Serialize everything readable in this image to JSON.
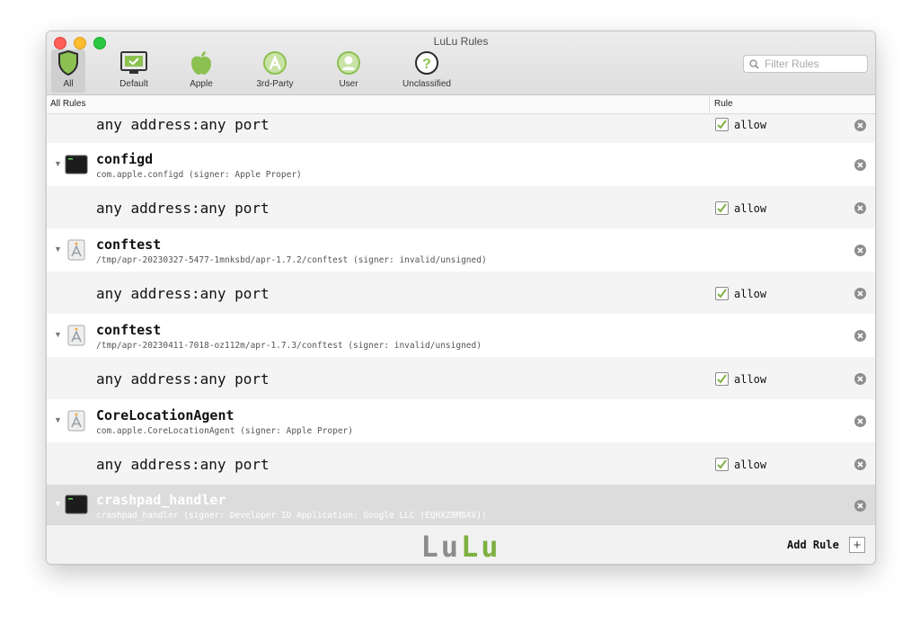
{
  "window": {
    "title": "LuLu Rules"
  },
  "toolbar": {
    "items": [
      {
        "label": "All",
        "icon": "shield-icon"
      },
      {
        "label": "Default",
        "icon": "monitor-icon"
      },
      {
        "label": "Apple",
        "icon": "apple-icon"
      },
      {
        "label": "3rd-Party",
        "icon": "app-store-icon"
      },
      {
        "label": "User",
        "icon": "user-icon"
      },
      {
        "label": "Unclassified",
        "icon": "question-icon"
      }
    ],
    "search_placeholder": "Filter Rules"
  },
  "columns": {
    "all_rules": "All Rules",
    "rule": "Rule"
  },
  "colors": {
    "green": "#7fb042",
    "toolbar_green": "#8cc152",
    "selected_row": "#dcdcdc",
    "logo_gray": "#8c8c8c"
  },
  "rows": [
    {
      "type": "rule",
      "text": "any address:any port",
      "action": "allow"
    },
    {
      "type": "app",
      "name": "configd",
      "path": "com.apple.configd (signer: Apple Proper)",
      "icon": "terminal-icon"
    },
    {
      "type": "rule",
      "text": "any address:any port",
      "action": "allow"
    },
    {
      "type": "app",
      "name": "conftest",
      "path": "/tmp/apr-20230327-5477-1mnksbd/apr-1.7.2/conftest (signer: invalid/unsigned)",
      "icon": "generic-app-icon"
    },
    {
      "type": "rule",
      "text": "any address:any port",
      "action": "allow"
    },
    {
      "type": "app",
      "name": "conftest",
      "path": "/tmp/apr-20230411-7018-oz112m/apr-1.7.3/conftest (signer: invalid/unsigned)",
      "icon": "generic-app-icon"
    },
    {
      "type": "rule",
      "text": "any address:any port",
      "action": "allow"
    },
    {
      "type": "app",
      "name": "CoreLocationAgent",
      "path": "com.apple.CoreLocationAgent (signer: Apple Proper)",
      "icon": "generic-app-icon"
    },
    {
      "type": "rule",
      "text": "any address:any port",
      "action": "allow"
    },
    {
      "type": "app",
      "name": "crashpad_handler",
      "path": "crashpad_handler (signer: Developer ID Application: Google LLC (EQHXZ8M8AV))",
      "icon": "terminal-icon",
      "selected": true
    }
  ],
  "footer": {
    "logo_part1": "Lu",
    "logo_part2": "Lu",
    "add_rule_label": "Add Rule",
    "add_button": "+"
  }
}
